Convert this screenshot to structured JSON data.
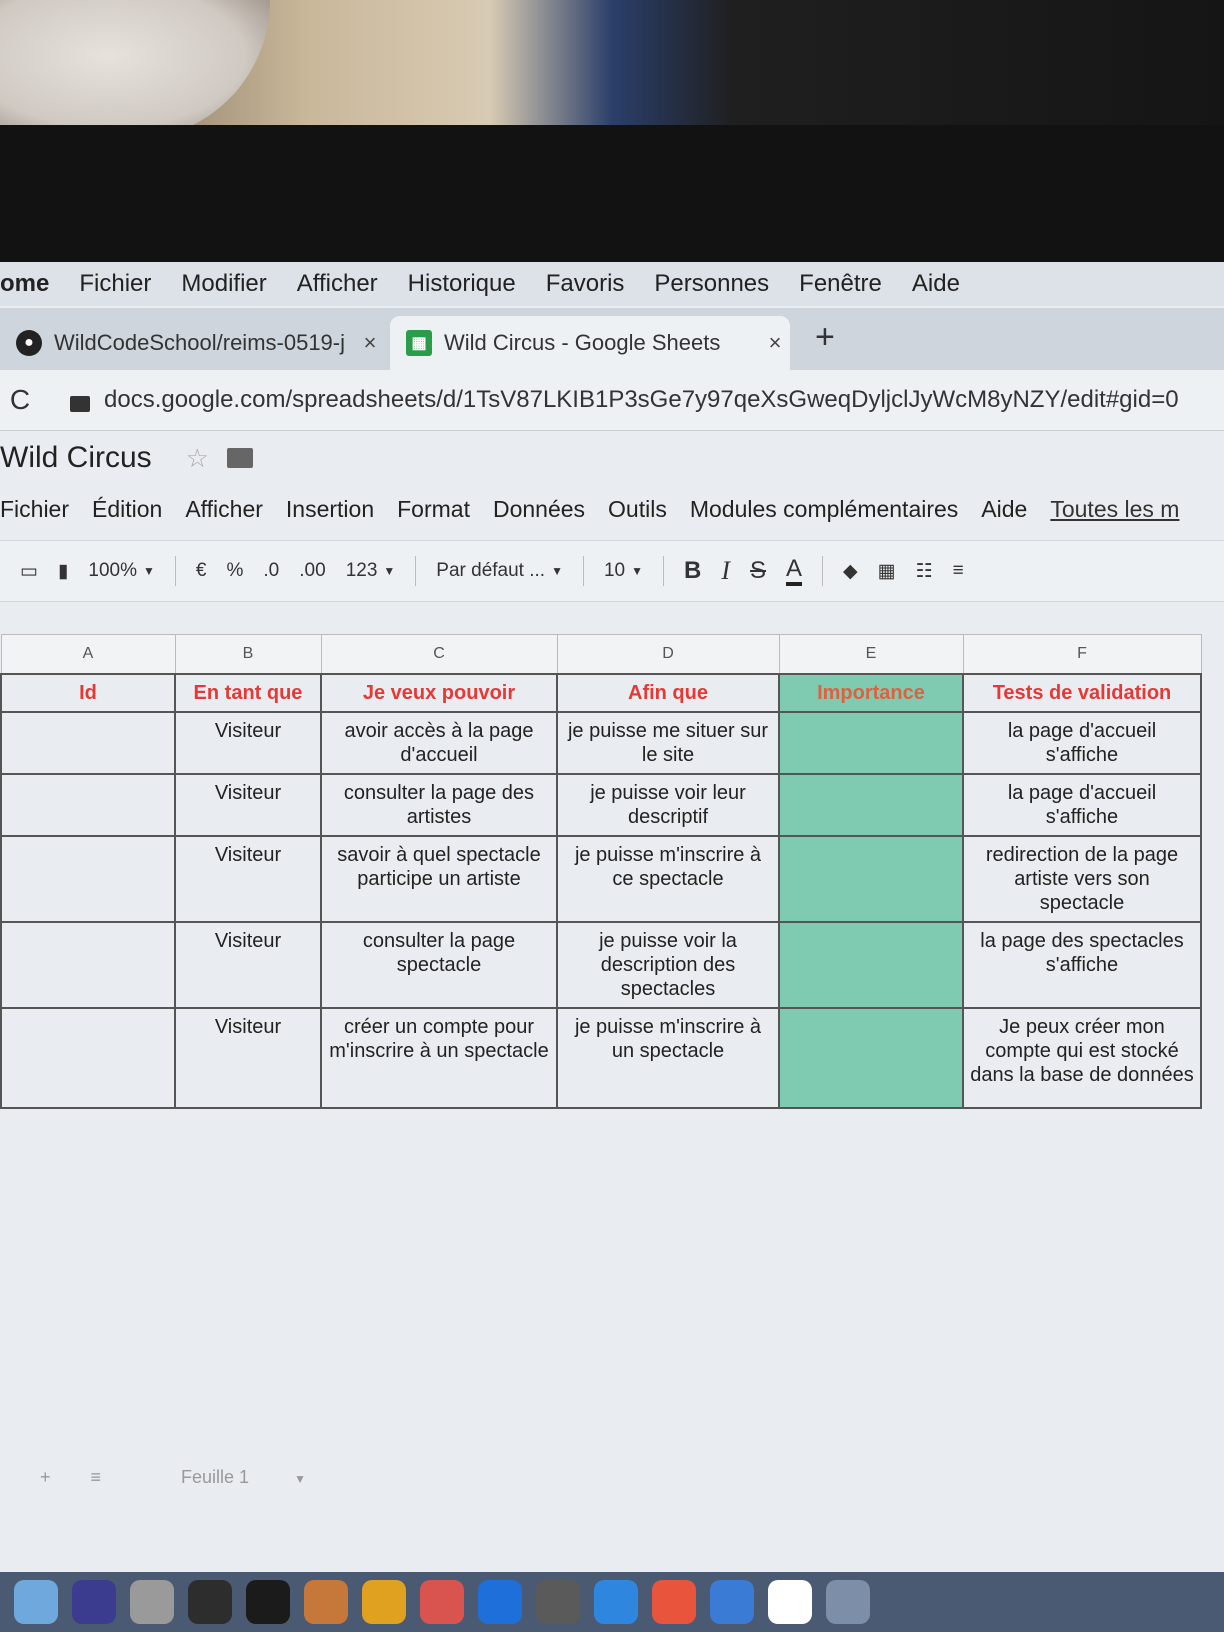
{
  "mac_menu": [
    "ome",
    "Fichier",
    "Modifier",
    "Afficher",
    "Historique",
    "Favoris",
    "Personnes",
    "Fenêtre",
    "Aide"
  ],
  "tabs": [
    {
      "title": "WildCodeSchool/reims-0519-j",
      "close": "×",
      "icon": "github-icon"
    },
    {
      "title": "Wild Circus - Google Sheets",
      "close": "×",
      "icon": "sheets-icon"
    }
  ],
  "new_tab": "+",
  "address": {
    "reload": "C",
    "url": "docs.google.com/spreadsheets/d/1TsV87LKIB1P3sGe7y97qeXsGweqDyljclJyWcM8yNZY/edit#gid=0"
  },
  "doc": {
    "title": "Wild Circus",
    "star": "☆"
  },
  "app_menu": [
    "Fichier",
    "Édition",
    "Afficher",
    "Insertion",
    "Format",
    "Données",
    "Outils",
    "Modules complémentaires",
    "Aide"
  ],
  "app_menu_link": "Toutes les m",
  "toolbar": {
    "zoom": "100%",
    "currency": "€",
    "percent": "%",
    "dec_less": ".0",
    "dec_more": ".00",
    "number_format": "123",
    "font": "Par défaut ...",
    "font_size": "10",
    "bold": "B",
    "italic": "I",
    "strike": "S",
    "text_color": "A"
  },
  "sheet": {
    "column_letters": [
      "A",
      "B",
      "C",
      "D",
      "E",
      "F"
    ],
    "header": [
      "Id",
      "En tant que",
      "Je veux pouvoir",
      "Afin que",
      "Importance",
      "Tests de validation"
    ],
    "rows": [
      [
        "",
        "Visiteur",
        "avoir accès à la page d'accueil",
        "je puisse me situer sur le site",
        "",
        "la page d'accueil s'affiche"
      ],
      [
        "",
        "Visiteur",
        "consulter la page des artistes",
        "je puisse voir leur descriptif",
        "",
        "la page d'accueil s'affiche"
      ],
      [
        "",
        "Visiteur",
        "savoir à quel spectacle participe un artiste",
        "je puisse m'inscrire à ce spectacle",
        "",
        "redirection de la page artiste vers son spectacle"
      ],
      [
        "",
        "Visiteur",
        "consulter la page spectacle",
        "je puisse voir la description des spectacles",
        "",
        "la page des spectacles s'affiche"
      ],
      [
        "",
        "Visiteur",
        "créer un compte pour m'inscrire à un spectacle",
        "je puisse m'inscrire à un spectacle",
        "",
        "Je peux créer mon compte qui est stocké dans la base de données"
      ]
    ],
    "importance_color": "#7fcbb2",
    "header_color": "#e53935"
  },
  "sheet_tabs": {
    "add": "+",
    "all": "≡",
    "current": "Feuille 1"
  },
  "dock_colors": [
    "#6fa8dc",
    "#3b3b8f",
    "#9a9a9a",
    "#2d2d2d",
    "#1b1b1b",
    "#c6783a",
    "#e0a020",
    "#d9534f",
    "#1e6fd9",
    "#5a5a5a",
    "#2e86de",
    "#e8543c",
    "#3a7bd5",
    "#ffffff",
    "#7d8fa8"
  ]
}
